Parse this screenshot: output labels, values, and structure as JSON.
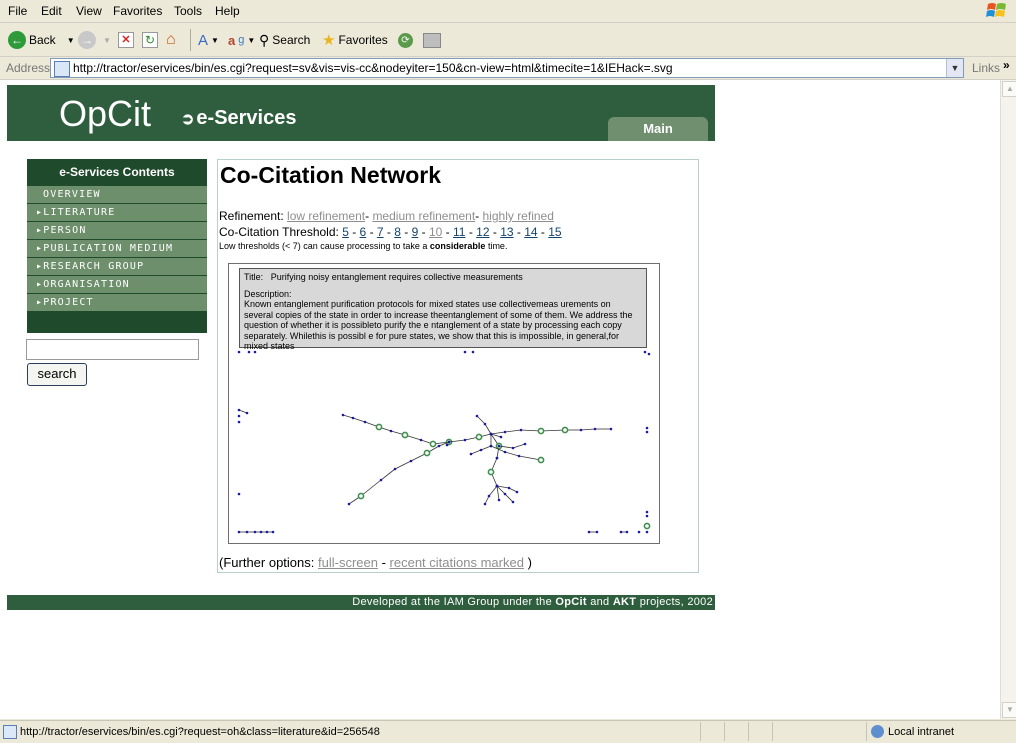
{
  "menu": [
    "File",
    "Edit",
    "View",
    "Favorites",
    "Tools",
    "Help"
  ],
  "toolbar": {
    "back_label": "Back",
    "search_label": "Search",
    "favorites_label": "Favorites"
  },
  "address": {
    "label": "Address",
    "url": "http://tractor/eservices/bin/es.cgi?request=sv&vis=vis-cc&nodeyiter=150&cn-view=html&timecite=1&IEHack=.svg",
    "links_label": "Links"
  },
  "status": {
    "text": "http://tractor/eservices/bin/es.cgi?request=oh&class=literature&id=256548",
    "zone": "Local intranet"
  },
  "site": {
    "logo": "OpCit",
    "subtitle": "e-Services",
    "main_tab": "Main",
    "sidebar_title": "e-Services Contents",
    "nav": [
      {
        "label": "Overview",
        "active": true
      },
      {
        "label": "Literature",
        "active": false
      },
      {
        "label": "Person",
        "active": false
      },
      {
        "label": "Publication Medium",
        "active": false
      },
      {
        "label": "Research Group",
        "active": false
      },
      {
        "label": "Organisation",
        "active": false
      },
      {
        "label": "Project",
        "active": false
      }
    ],
    "search_button": "search",
    "search_value": ""
  },
  "content": {
    "title": "Co-Citation Network",
    "refinement_label": "Refinement:",
    "refinement_options": [
      "low refinement",
      "medium refinement",
      "highly refined"
    ],
    "threshold_label": "Co-Citation Threshold:",
    "thresholds": [
      "5",
      "6",
      "7",
      "8",
      "9",
      "10",
      "11",
      "12",
      "13",
      "14",
      "15"
    ],
    "threshold_selected": "10",
    "warning_prefix": "Low thresholds (< 7) can cause processing to take a",
    "warning_bold": "considerable",
    "warning_suffix": "time.",
    "popup": {
      "title_label": "Title:",
      "title_value": "Purifying noisy entanglement requires collective measurements",
      "desc_label": "Description:",
      "desc_text": "Known entanglement purification protocols for mixed states use collectivemeas urements on several copies of the state in order to increase theentanglement of some of them. We address the question of whether it is possibleto purify the e ntanglement of a state by processing each copy separately. Whilethis is possibl e for pure states, we show that this is impossible, in general,for mixed states"
    },
    "further_prefix": "(Further options:",
    "further_links": [
      "full-screen",
      "recent citations marked"
    ],
    "further_suffix": ")"
  },
  "footer": {
    "prefix": "Developed at the IAM Group under the",
    "opcit": "OpCit",
    "and": "and",
    "akt": "AKT",
    "suffix": "projects, 2002"
  },
  "colors": {
    "header_green": "#2e5e3d",
    "nav_green": "#6d8f6b",
    "link_blue": "#14446b",
    "link_grey": "#8e8e8e",
    "node_blue": "#1a1aa0",
    "node_green": "#3f8f4f"
  }
}
